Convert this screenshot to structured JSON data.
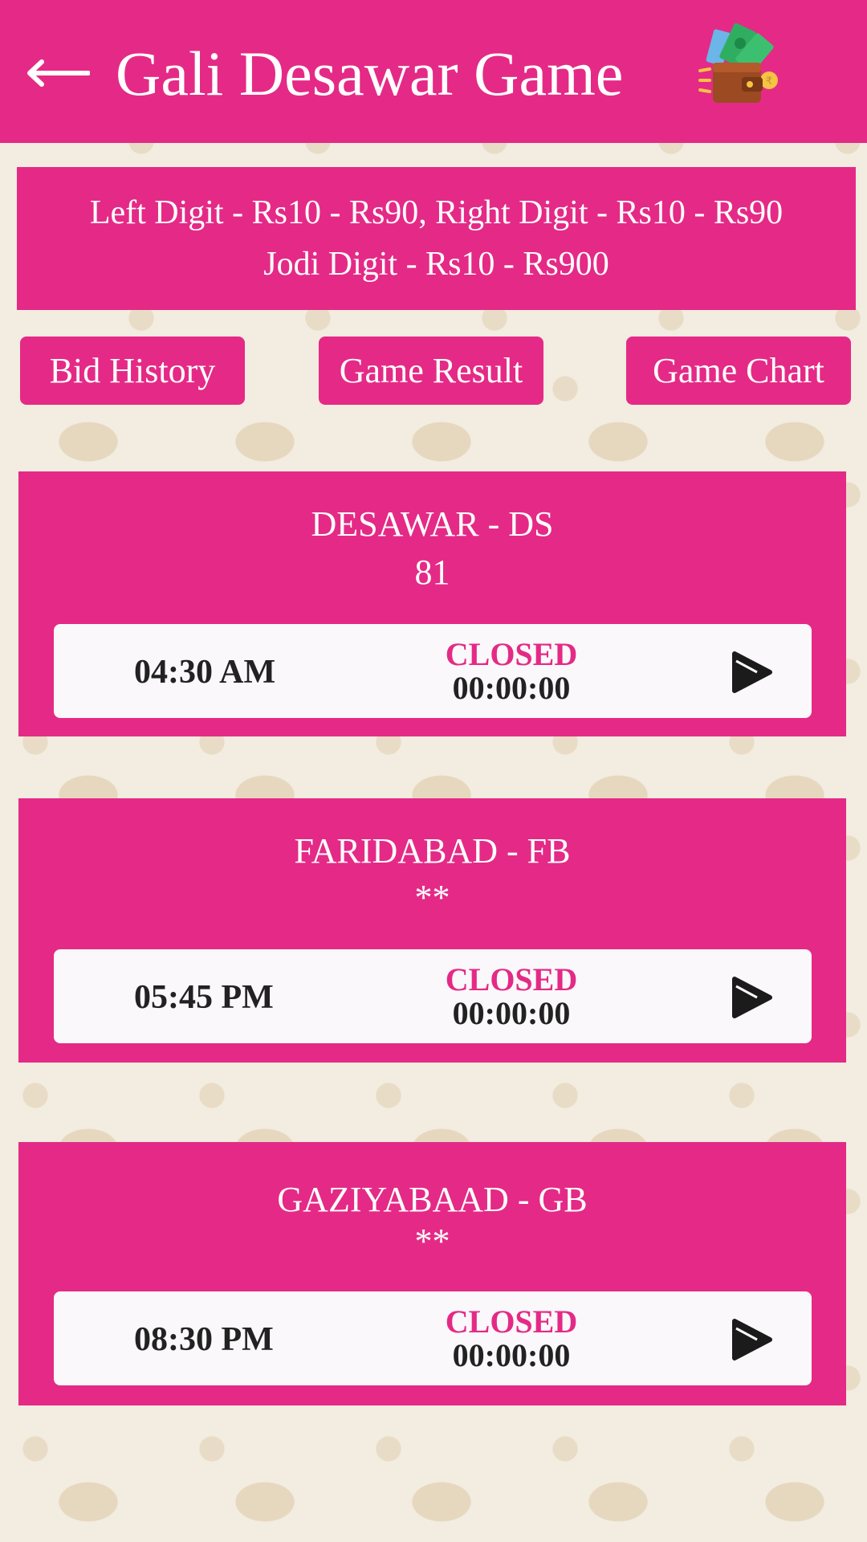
{
  "header": {
    "title": "Gali Desawar Game",
    "back_icon": "arrow-left-icon",
    "wallet_icon": "wallet-icon"
  },
  "rates": {
    "line1": "Left Digit - Rs10 - Rs90, Right Digit - Rs10 - Rs90",
    "line2": "Jodi Digit - Rs10 - Rs900"
  },
  "nav": {
    "bid_history": "Bid History",
    "game_result": "Game Result",
    "game_chart": "Game Chart"
  },
  "games": [
    {
      "name": "DESAWAR - DS",
      "result": "81",
      "time": "04:30 AM",
      "status": "CLOSED",
      "timer": "00:00:00"
    },
    {
      "name": "FARIDABAD - FB",
      "result": "**",
      "time": "05:45 PM",
      "status": "CLOSED",
      "timer": "00:00:00"
    },
    {
      "name": "GAZIYABAAD - GB",
      "result": "**",
      "time": "08:30 PM",
      "status": "CLOSED",
      "timer": "00:00:00"
    }
  ],
  "colors": {
    "accent": "#e42a86",
    "background": "#f3ece0",
    "card_row": "#faf8fa",
    "text_dark": "#222222"
  }
}
